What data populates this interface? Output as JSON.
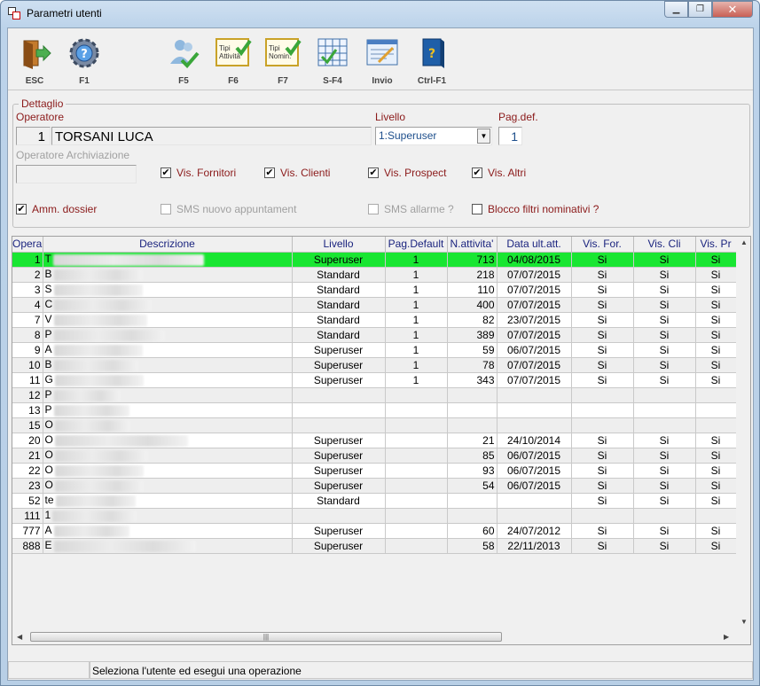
{
  "window": {
    "title": "Parametri utenti"
  },
  "toolbar": [
    {
      "key": "ESC",
      "icon": "exit-door-icon"
    },
    {
      "key": "F1",
      "icon": "gear-help-icon"
    },
    {
      "key": "F5",
      "icon": "users-check-icon"
    },
    {
      "key": "F6",
      "icon": "tipi-attivita-icon",
      "caption": [
        "Tipi",
        "Attività"
      ]
    },
    {
      "key": "F7",
      "icon": "tipi-nominativi-icon",
      "caption": [
        "Tipi",
        "Nomin."
      ]
    },
    {
      "key": "S-F4",
      "icon": "grid-check-icon"
    },
    {
      "key": "Invio",
      "icon": "edit-form-icon"
    },
    {
      "key": "Ctrl-F1",
      "icon": "help-book-icon"
    }
  ],
  "detail": {
    "legend": "Dettaglio",
    "operatore_label": "Operatore",
    "operatore_id": "1",
    "operatore_name": "TORSANI LUCA",
    "livello_label": "Livello",
    "livello_value": "1:Superuser",
    "pagdef_label": "Pag.def.",
    "pagdef_value": "1",
    "archiviazione_label": "Operatore Archiviazione",
    "archiviazione_value": "",
    "checks": {
      "vis_fornitori": {
        "label": "Vis. Fornitori",
        "checked": true
      },
      "vis_clienti": {
        "label": "Vis. Clienti",
        "checked": true
      },
      "vis_prospect": {
        "label": "Vis. Prospect",
        "checked": true
      },
      "vis_altri": {
        "label": "Vis. Altri",
        "checked": true
      },
      "amm_dossier": {
        "label": "Amm. dossier",
        "checked": true
      },
      "sms_appuntamento": {
        "label": "SMS nuovo appuntament",
        "checked": false
      },
      "sms_allarme": {
        "label": "SMS allarme ?",
        "checked": false
      },
      "blocco_filtri": {
        "label": "Blocco filtri nominativi ?",
        "checked": false
      }
    }
  },
  "grid": {
    "columns": [
      "Opera",
      "Descrizione",
      "Livello",
      "Pag.Default",
      "N.attivita'",
      "Data ult.att.",
      "Vis. For.",
      "Vis. Cli",
      "Vis. Pr"
    ],
    "rows": [
      {
        "id": "1",
        "desc": "T",
        "livello": "Superuser",
        "pag": "1",
        "natt": "713",
        "data": "04/08/2015",
        "vf": "Si",
        "vc": "Si",
        "vp": "Si",
        "selected": true
      },
      {
        "id": "2",
        "desc": "B",
        "livello": "Standard",
        "pag": "1",
        "natt": "218",
        "data": "07/07/2015",
        "vf": "Si",
        "vc": "Si",
        "vp": "Si"
      },
      {
        "id": "3",
        "desc": "S",
        "livello": "Standard",
        "pag": "1",
        "natt": "110",
        "data": "07/07/2015",
        "vf": "Si",
        "vc": "Si",
        "vp": "Si"
      },
      {
        "id": "4",
        "desc": "C",
        "livello": "Standard",
        "pag": "1",
        "natt": "400",
        "data": "07/07/2015",
        "vf": "Si",
        "vc": "Si",
        "vp": "Si"
      },
      {
        "id": "7",
        "desc": "V",
        "livello": "Standard",
        "pag": "1",
        "natt": "82",
        "data": "23/07/2015",
        "vf": "Si",
        "vc": "Si",
        "vp": "Si"
      },
      {
        "id": "8",
        "desc": "P",
        "livello": "Standard",
        "pag": "1",
        "natt": "389",
        "data": "07/07/2015",
        "vf": "Si",
        "vc": "Si",
        "vp": "Si"
      },
      {
        "id": "9",
        "desc": "A",
        "livello": "Superuser",
        "pag": "1",
        "natt": "59",
        "data": "06/07/2015",
        "vf": "Si",
        "vc": "Si",
        "vp": "Si"
      },
      {
        "id": "10",
        "desc": "B",
        "livello": "Superuser",
        "pag": "1",
        "natt": "78",
        "data": "07/07/2015",
        "vf": "Si",
        "vc": "Si",
        "vp": "Si"
      },
      {
        "id": "11",
        "desc": "G",
        "livello": "Superuser",
        "pag": "1",
        "natt": "343",
        "data": "07/07/2015",
        "vf": "Si",
        "vc": "Si",
        "vp": "Si"
      },
      {
        "id": "12",
        "desc": "P",
        "livello": "",
        "pag": "",
        "natt": "",
        "data": "",
        "vf": "",
        "vc": "",
        "vp": ""
      },
      {
        "id": "13",
        "desc": "P",
        "livello": "",
        "pag": "",
        "natt": "",
        "data": "",
        "vf": "",
        "vc": "",
        "vp": ""
      },
      {
        "id": "15",
        "desc": "O",
        "livello": "",
        "pag": "",
        "natt": "",
        "data": "",
        "vf": "",
        "vc": "",
        "vp": ""
      },
      {
        "id": "20",
        "desc": "O",
        "livello": "Superuser",
        "pag": "",
        "natt": "21",
        "data": "24/10/2014",
        "vf": "Si",
        "vc": "Si",
        "vp": "Si"
      },
      {
        "id": "21",
        "desc": "O",
        "livello": "Superuser",
        "pag": "",
        "natt": "85",
        "data": "06/07/2015",
        "vf": "Si",
        "vc": "Si",
        "vp": "Si"
      },
      {
        "id": "22",
        "desc": "O",
        "livello": "Superuser",
        "pag": "",
        "natt": "93",
        "data": "06/07/2015",
        "vf": "Si",
        "vc": "Si",
        "vp": "Si"
      },
      {
        "id": "23",
        "desc": "O",
        "livello": "Superuser",
        "pag": "",
        "natt": "54",
        "data": "06/07/2015",
        "vf": "Si",
        "vc": "Si",
        "vp": "Si"
      },
      {
        "id": "52",
        "desc": "te",
        "livello": "Standard",
        "pag": "",
        "natt": "",
        "data": "",
        "vf": "Si",
        "vc": "Si",
        "vp": "Si"
      },
      {
        "id": "111",
        "desc": "1",
        "livello": "",
        "pag": "",
        "natt": "",
        "data": "",
        "vf": "",
        "vc": "",
        "vp": ""
      },
      {
        "id": "777",
        "desc": "A",
        "livello": "Superuser",
        "pag": "",
        "natt": "60",
        "data": "24/07/2012",
        "vf": "Si",
        "vc": "Si",
        "vp": "Si"
      },
      {
        "id": "888",
        "desc": "E",
        "livello": "Superuser",
        "pag": "",
        "natt": "58",
        "data": "22/11/2013",
        "vf": "Si",
        "vc": "Si",
        "vp": "Si"
      }
    ]
  },
  "status": {
    "text": "Seleziona l'utente ed esegui una operazione"
  },
  "colors": {
    "selected_row": "#19e632",
    "label": "#8b1a1a",
    "header_text": "#1a237e"
  }
}
